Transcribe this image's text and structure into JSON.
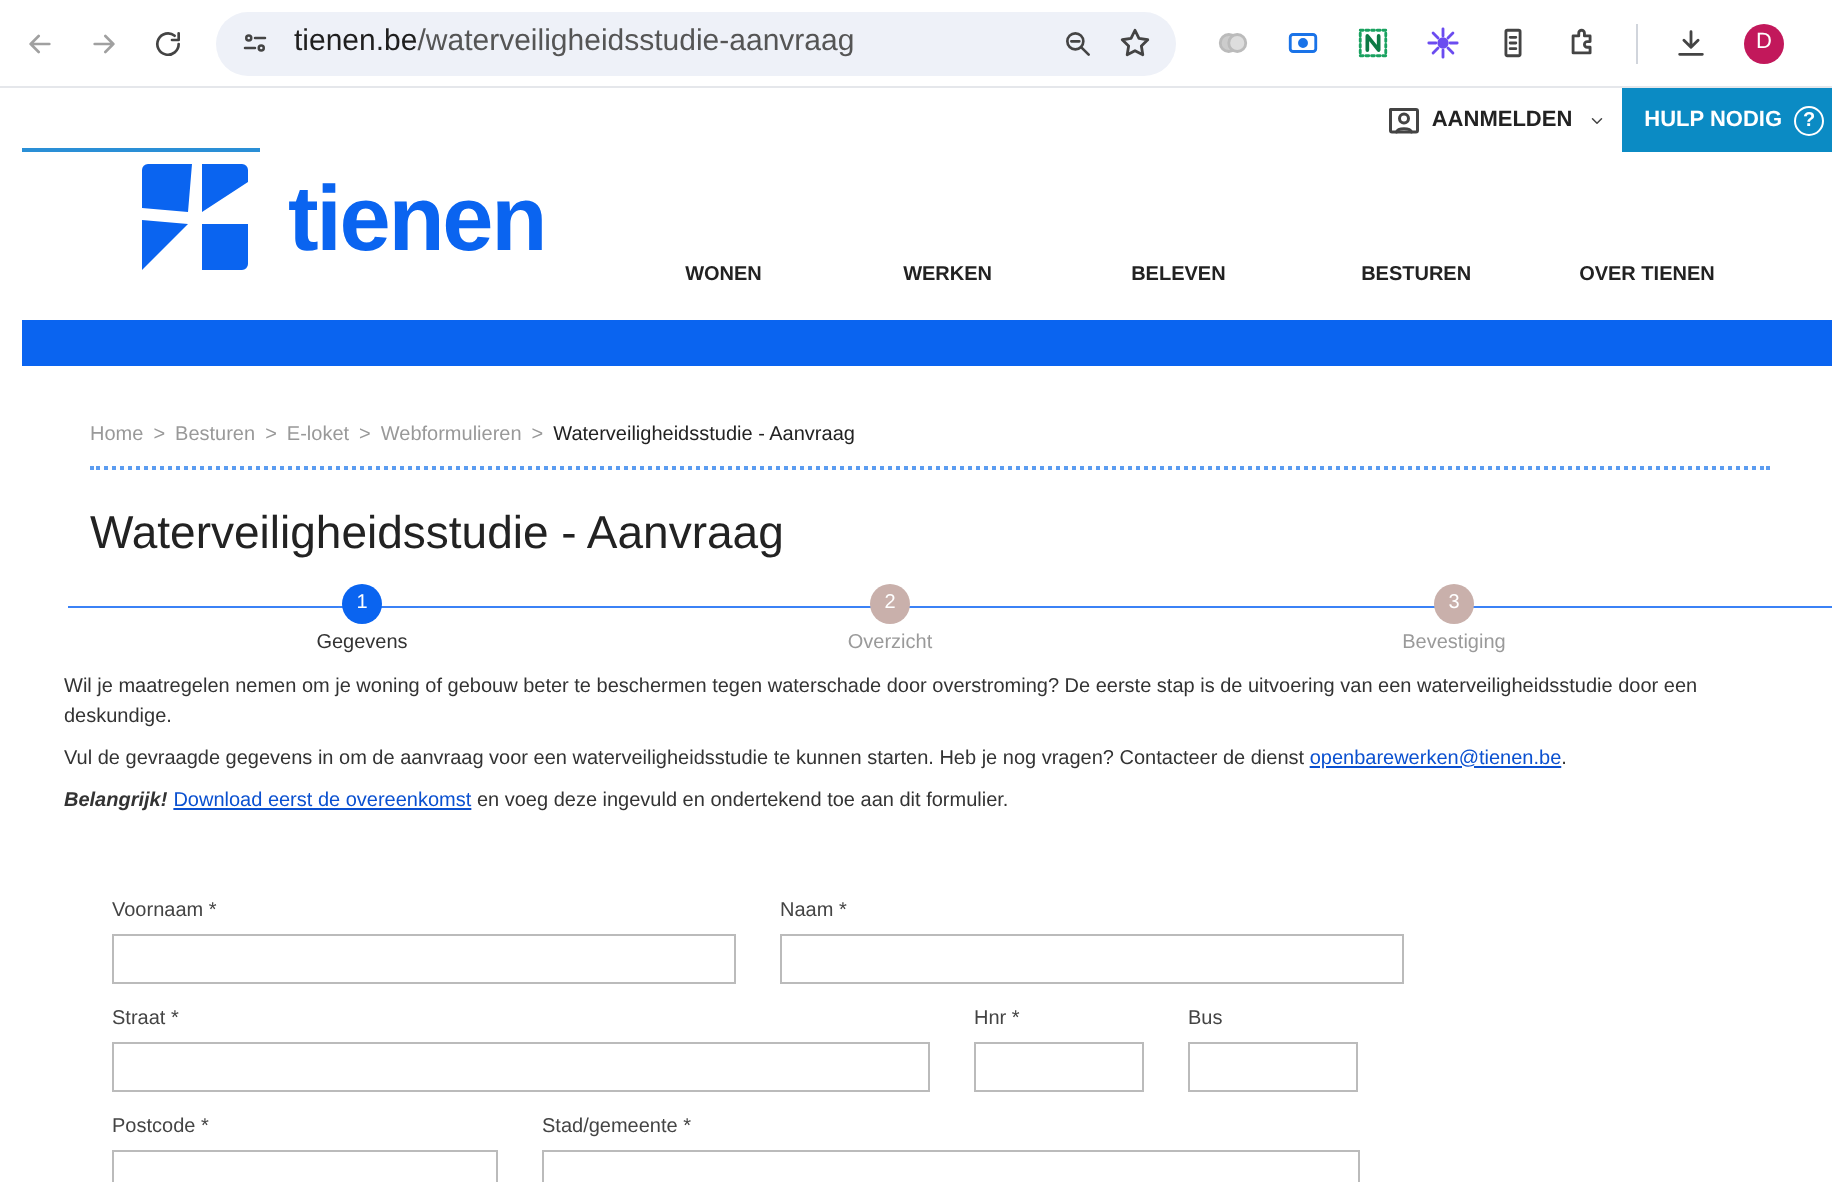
{
  "browser": {
    "url_host": "tienen.be",
    "url_path": "/waterveiligheidsstudie-aanvraag",
    "profile_initial": "D"
  },
  "header": {
    "login": "AANMELDEN",
    "help": "HULP NODIG",
    "help_icon": "?"
  },
  "logo": {
    "text": "tienen"
  },
  "nav": [
    {
      "label": "WONEN"
    },
    {
      "label": "WERKEN"
    },
    {
      "label": "BELEVEN"
    },
    {
      "label": "BESTUREN"
    },
    {
      "label": "OVER TIENEN"
    }
  ],
  "breadcrumb": [
    {
      "label": "Home",
      "current": false
    },
    {
      "label": "Besturen",
      "current": false
    },
    {
      "label": "E-loket",
      "current": false
    },
    {
      "label": "Webformulieren",
      "current": false
    },
    {
      "label": "Waterveiligheidsstudie - Aanvraag",
      "current": true
    }
  ],
  "breadcrumb_separator": ">",
  "title": "Waterveiligheidsstudie - Aanvraag",
  "steps": [
    {
      "number": "1",
      "label": "Gegevens",
      "selected": true
    },
    {
      "number": "2",
      "label": "Overzicht",
      "selected": false
    },
    {
      "number": "3",
      "label": "Bevestiging",
      "selected": false
    }
  ],
  "paragraphs": [
    [
      {
        "kind": "text",
        "text": "Wil je maatregelen nemen om je woning of gebouw beter te beschermen tegen waterschade door overstroming? De eerste stap is de uitvoering van een waterveiligheidsstudie door een deskundige."
      }
    ],
    [
      {
        "kind": "text",
        "text": "Vul de gevraagde gegevens in om de aanvraag voor een waterveiligheidsstudie te kunnen starten. Heb je nog vragen? Contacteer de dienst "
      },
      {
        "kind": "link",
        "text": "openbarewerken@tienen.be"
      },
      {
        "kind": "text",
        "text": "."
      }
    ],
    [
      {
        "kind": "emphasis",
        "text": "Belangrijk!"
      },
      {
        "kind": "link",
        "text": "Download eerst de overeenkomst"
      },
      {
        "kind": "text",
        "text": " en voeg deze ingevuld en ondertekend toe aan dit formulier."
      }
    ]
  ],
  "form_rows": [
    [
      {
        "label": "Voornaam *"
      },
      {
        "label": "Naam *"
      }
    ],
    [
      {
        "label": "Straat *"
      },
      {
        "label": "Hnr *"
      },
      {
        "label": "Bus"
      }
    ],
    [
      {
        "label": "Postcode *"
      },
      {
        "label": "Stad/gemeente *"
      }
    ]
  ]
}
